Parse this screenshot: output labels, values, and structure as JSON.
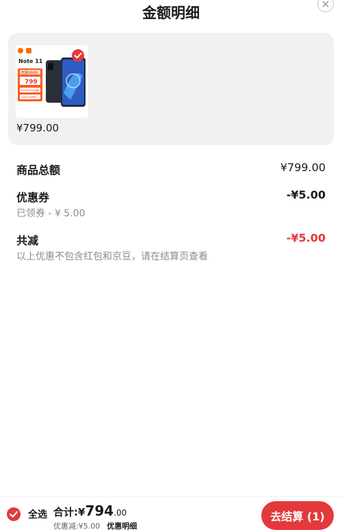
{
  "header": {
    "title": "金额明细",
    "close_icon": "close-icon"
  },
  "product": {
    "price": "¥799.00",
    "selected": true,
    "image_icon": "phone-product-image",
    "image_text": {
      "model": "Note 11",
      "tag": "优惠500元",
      "price": "799",
      "spec1": "5000mAh大电量",
      "spec2": "33W Pro快充"
    }
  },
  "summary": {
    "goods_total_label": "商品总额",
    "goods_total_value": "¥799.00",
    "coupon_label": "优惠券",
    "coupon_value": "-¥5.00",
    "coupon_sub": "已领券 - ¥ 5.00",
    "total_reduce_label": "共减",
    "total_reduce_value": "-¥5.00",
    "total_reduce_note": "以上优惠不包含红包和京豆，请在结算页查看"
  },
  "bottom": {
    "select_all_label": "全选",
    "total_label": "合计:",
    "total_symbol": "¥",
    "total_int": "794",
    "total_dec": ".00",
    "discount_text": "优惠减:¥5.00",
    "detail_link": "优惠明细",
    "checkout_label": "去结算 (1)"
  },
  "colors": {
    "accent": "#e4393c",
    "card_bg": "#f1f1f1"
  }
}
